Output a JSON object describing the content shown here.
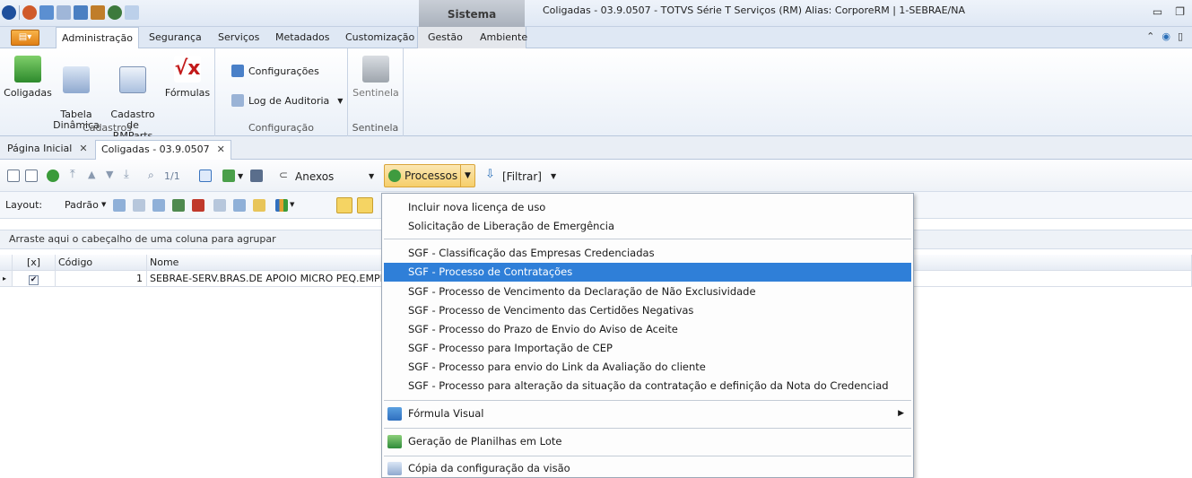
{
  "window": {
    "context_tab": "Sistema",
    "title": "Coligadas - 03.9.0507 - TOTVS Série T Serviços (RM) Alias: CorporeRM | 1-SEBRAE/NA"
  },
  "ribbon_tabs": [
    "Administração",
    "Segurança",
    "Serviços",
    "Metadados",
    "Customização",
    "Gestão",
    "Ambiente"
  ],
  "ribbon": {
    "cadastros": {
      "buttons": [
        "Coligadas",
        "Tabela\nDinâmica",
        "Cadastro\nde RMParts",
        "Fórmulas"
      ],
      "label": "Cadastros"
    },
    "configuracao": {
      "configuracoes": "Configurações",
      "log": "Log de Auditoria",
      "label": "Configuração"
    },
    "sentinela": {
      "button": "Sentinela",
      "label": "Sentinela"
    }
  },
  "doc_tabs": [
    "Página Inicial",
    "Coligadas - 03.9.0507"
  ],
  "toolbar": {
    "page": "1/1",
    "anexos": "Anexos",
    "processos": "Processos",
    "filtrar": "[Filtrar]"
  },
  "toolbar2": {
    "layout": "Layout:",
    "padrao": "Padrão"
  },
  "group_panel": "Arraste aqui o cabeçalho de uma coluna para agrupar",
  "grid": {
    "headers": [
      "[x]",
      "Código",
      "Nome"
    ],
    "rows": [
      {
        "checked": true,
        "codigo": "1",
        "nome": "SEBRAE-SERV.BRAS.DE APOIO MICRO PEQ.EMPR"
      }
    ]
  },
  "menu": {
    "items": [
      "Incluir nova licença de uso",
      "Solicitação de Liberação de Emergência",
      "SGF - Classificação das Empresas Credenciadas",
      "SGF - Processo de Contratações",
      "SGF - Processo de Vencimento da Declaração de Não Exclusividade",
      "SGF - Processo de Vencimento das Certidões Negativas",
      "SGF - Processo do Prazo de Envio do Aviso de Aceite",
      "SGF - Processo para Importação de CEP",
      "SGF - Processo para envio do Link da Avaliação do cliente",
      "SGF - Processo para alteração da situação da contratação e definição da Nota do Credenciad",
      "Fórmula Visual",
      "Geração de Planilhas em Lote",
      "Cópia da configuração da visão"
    ],
    "highlighted_index": 3
  },
  "colors": {
    "highlight": "#2f7fd8",
    "processos_button": "#f6cf6a",
    "context_tab": "#a9b1bc"
  }
}
